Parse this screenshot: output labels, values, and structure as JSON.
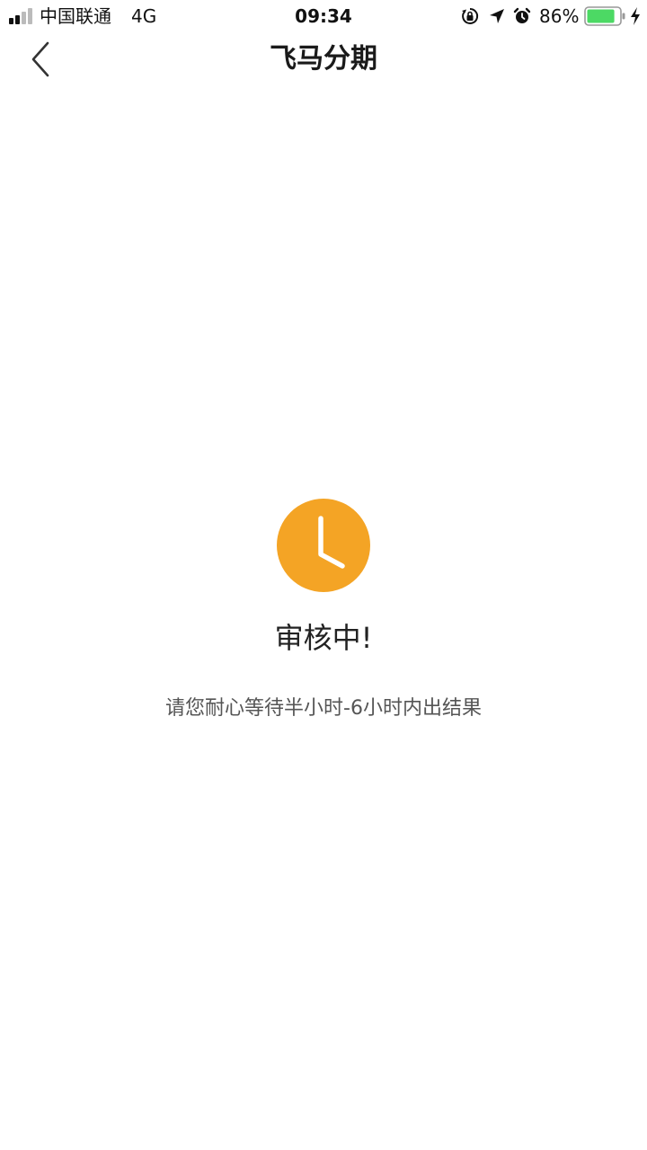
{
  "status_bar": {
    "carrier": "中国联通",
    "network": "4G",
    "time": "09:34",
    "battery_percent": "86%",
    "battery_level": 0.86,
    "icons": [
      "signal-icon",
      "orientation-lock-icon",
      "location-arrow-icon",
      "alarm-icon",
      "battery-icon",
      "charging-bolt-icon"
    ]
  },
  "nav": {
    "title": "飞马分期",
    "back_icon": "chevron-left-icon"
  },
  "review_status": {
    "icon": "clock-icon",
    "icon_color": "#F4A425",
    "title": "审核中!",
    "description": "请您耐心等待半小时-6小时内出结果"
  },
  "colors": {
    "accent": "#F4A425",
    "battery_fill": "#4CD964"
  }
}
